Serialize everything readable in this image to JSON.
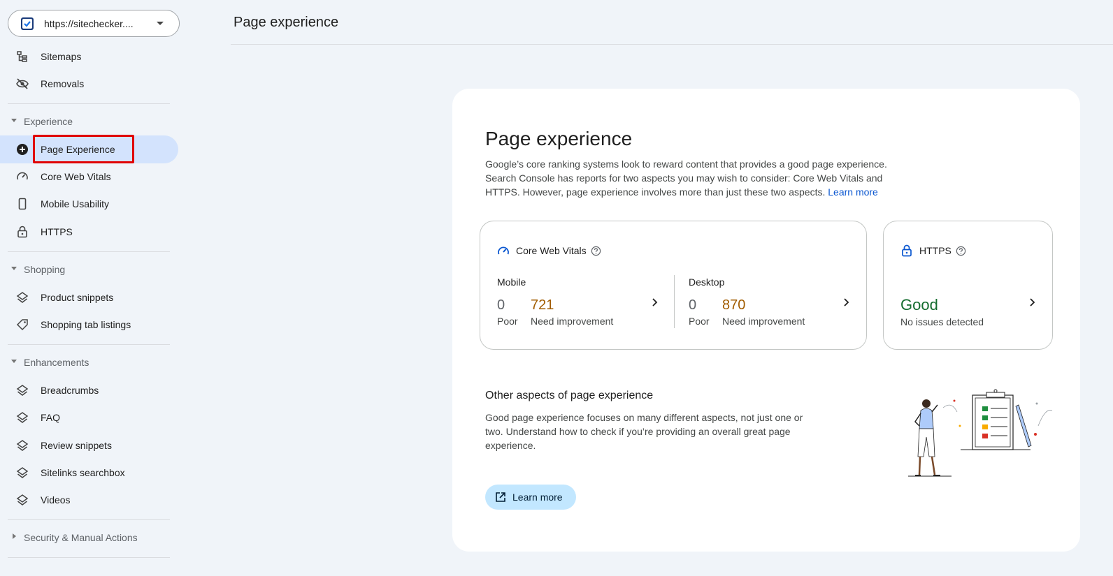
{
  "property": {
    "url": "https://sitechecker...."
  },
  "sidebar": {
    "top_items": [
      {
        "label": "Sitemaps",
        "icon": "sitemap-icon"
      },
      {
        "label": "Removals",
        "icon": "eye-off-icon"
      }
    ],
    "sections": [
      {
        "label": "Experience",
        "items": [
          {
            "label": "Page Experience",
            "icon": "plus-circle-icon",
            "active": true
          },
          {
            "label": "Core Web Vitals",
            "icon": "gauge-icon"
          },
          {
            "label": "Mobile Usability",
            "icon": "phone-icon"
          },
          {
            "label": "HTTPS",
            "icon": "lock-icon"
          }
        ]
      },
      {
        "label": "Shopping",
        "items": [
          {
            "label": "Product snippets",
            "icon": "layers-icon"
          },
          {
            "label": "Shopping tab listings",
            "icon": "tag-icon"
          }
        ]
      },
      {
        "label": "Enhancements",
        "items": [
          {
            "label": "Breadcrumbs",
            "icon": "layers-icon"
          },
          {
            "label": "FAQ",
            "icon": "layers-icon"
          },
          {
            "label": "Review snippets",
            "icon": "layers-icon"
          },
          {
            "label": "Sitelinks searchbox",
            "icon": "layers-icon"
          },
          {
            "label": "Videos",
            "icon": "layers-icon"
          }
        ]
      },
      {
        "label": "Security & Manual Actions",
        "collapsed": true
      }
    ]
  },
  "header": {
    "title": "Page experience"
  },
  "main": {
    "title": "Page experience",
    "description": "Google’s core ranking systems look to reward content that provides a good page experience. Search Console has reports for two aspects you may wish to consider: Core Web Vitals and HTTPS. However, page experience involves more than just these two aspects.",
    "learn_more_link": "Learn more",
    "cwv": {
      "title": "Core Web Vitals",
      "mobile": {
        "label": "Mobile",
        "poor": "0",
        "poor_label": "Poor",
        "need": "721",
        "need_label": "Need improvement"
      },
      "desktop": {
        "label": "Desktop",
        "poor": "0",
        "poor_label": "Poor",
        "need": "870",
        "need_label": "Need improvement"
      }
    },
    "https": {
      "title": "HTTPS",
      "status": "Good",
      "detail": "No issues detected"
    },
    "other": {
      "title": "Other aspects of page experience",
      "description": "Good page experience focuses on many different aspects, not just one or two. Understand how to check if you’re providing an overall great page experience.",
      "button": "Learn more"
    }
  },
  "colors": {
    "active_bg": "#d3e3fd",
    "good": "#146c2e",
    "need_improvement": "#a15c00",
    "link": "#0b57d0",
    "button_bg": "#c2e7ff",
    "highlight": "#e00000"
  }
}
